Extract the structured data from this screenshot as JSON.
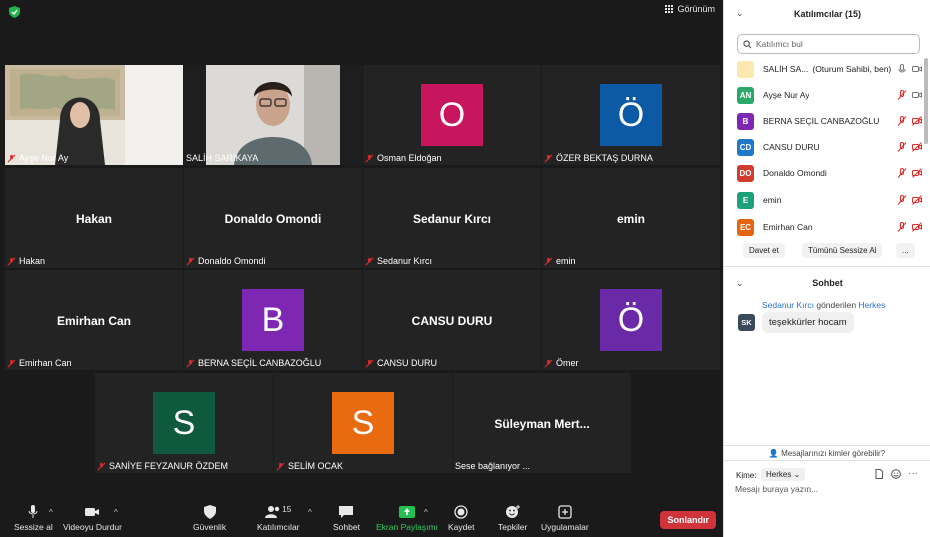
{
  "view": {
    "label": "Görünüm"
  },
  "tiles": [
    {
      "name": "Ayşe Nur Ay"
    },
    {
      "name": "SALİH SARIKAYA"
    },
    {
      "name": "Osman Eldoğan",
      "initial": "O"
    },
    {
      "name": "ÖZER BEKTAŞ DURNA",
      "initial": "Ö"
    },
    {
      "name": "Hakan",
      "big": "Hakan"
    },
    {
      "name": "Donaldo Omondi",
      "big": "Donaldo Omondi"
    },
    {
      "name": "Sedanur Kırcı",
      "big": "Sedanur Kırcı"
    },
    {
      "name": "emin",
      "big": "emin"
    },
    {
      "name": "Emirhan Can",
      "big": "Emirhan Can"
    },
    {
      "name": "BERNA SEÇİL CANBAZOĞLU",
      "initial": "B"
    },
    {
      "name": "CANSU DURU",
      "big": "CANSU DURU"
    },
    {
      "name": "Ömer",
      "initial": "Ö"
    },
    {
      "name": "SANİYE FEYZANUR ÖZDEM",
      "initial": "S"
    },
    {
      "name": "SELİM OCAK",
      "initial": "S"
    },
    {
      "name": "Sese bağlanıyor ...",
      "big": "Süleyman Mert..."
    }
  ],
  "colors": {
    "osman": "#c7155e",
    "ozer": "#0c5aa6",
    "berna": "#7e27b3",
    "omer": "#6a2aa8",
    "saniye": "#0f5a3e",
    "selim": "#e96b10",
    "active_border": "#c8e66c",
    "end_button": "#d0343a"
  },
  "toolbar": {
    "mute": "Sessize al",
    "video": "Videoyu Durdur",
    "security": "Güvenlik",
    "participants": "Katılımcılar",
    "participants_count": "15",
    "chat": "Sohbet",
    "share": "Ekran Paylaşımı",
    "record": "Kaydet",
    "reactions": "Tepkiler",
    "apps": "Uygulamalar",
    "end": "Sonlandır"
  },
  "panel": {
    "title": "Katılımcılar (15)",
    "search_placeholder": "Katılımcı bul",
    "participants": [
      {
        "initials": "",
        "name": "SALİH SA...",
        "role": "(Oturum Sahibi, ben)",
        "color": "#fde9b0"
      },
      {
        "initials": "AN",
        "name": "Ayşe Nur Ay",
        "color": "#2aa86a"
      },
      {
        "initials": "B",
        "name": "BERNA SEÇİL CANBAZOĞLU",
        "color": "#7e27b3"
      },
      {
        "initials": "CD",
        "name": "CANSU DURU",
        "color": "#1f78c8"
      },
      {
        "initials": "DO",
        "name": "Donaldo Omondi",
        "color": "#d23c2e"
      },
      {
        "initials": "E",
        "name": "emin",
        "color": "#1ea07a"
      },
      {
        "initials": "EC",
        "name": "Emirhan Can",
        "color": "#e5650f"
      }
    ],
    "invite": "Davet et",
    "mute_all": "Tümünü Sessize Al",
    "more": "..."
  },
  "chat": {
    "title": "Sohbet",
    "sender": "Sedanur Kırcı",
    "sent_to_text": " gönderilen ",
    "recipient": "Herkes",
    "sender_initials": "SK",
    "message": "teşekkürler hocam",
    "who_can_see": "Mesajlarınızı kimler görebilir?",
    "to_label": "Kime:",
    "to_value": "Herkes",
    "input_placeholder": "Mesajı buraya yazın..."
  }
}
